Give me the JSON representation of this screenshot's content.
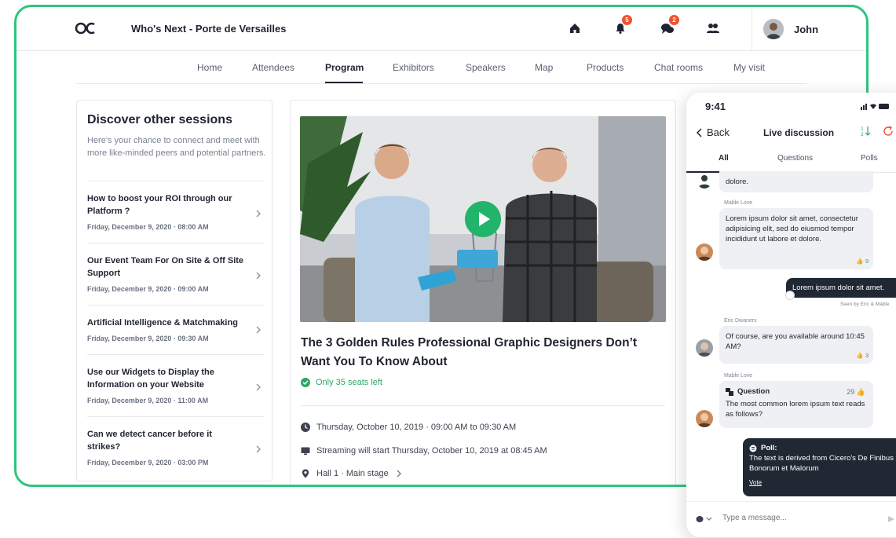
{
  "app": {
    "event_title": "Who's Next - Porte de Versailles",
    "user_name": "John",
    "badges": {
      "notifications": "5",
      "messages": "2"
    },
    "accent_color": "#2ec57d"
  },
  "nav": {
    "items": [
      "Home",
      "Attendees",
      "Program",
      "Exhibitors",
      "Speakers",
      "Map",
      "Products",
      "Chat rooms",
      "My visit"
    ],
    "active": "Program"
  },
  "sidebar": {
    "title": "Discover other sessions",
    "description": "Here's your chance to connect and meet with more like-minded peers and potential partners.",
    "sessions": [
      {
        "title": "How to boost your ROI through our Platform ?",
        "date": "Friday, December 9, 2020 · 08:00 AM"
      },
      {
        "title": "Our Event Team For On Site & Off Site Support",
        "date": "Friday, December 9, 2020 · 09:00 AM"
      },
      {
        "title": "Artificial Intelligence & Matchmaking",
        "date": "Friday, December 9, 2020 · 09:30 AM"
      },
      {
        "title": "Use our Widgets to Display the Information on your Website",
        "date": "Friday, December 9, 2020 · 11:00 AM"
      },
      {
        "title": "Can we detect cancer before it strikes?",
        "date": "Friday, December 9, 2020 · 03:00 PM"
      }
    ]
  },
  "session": {
    "title": "The 3 Golden Rules Professional Graphic Designers Don’t Want You To Know About",
    "seats": "Only 35 seats left",
    "time": "Thursday, October 10, 2019 · 09:00 AM to 09:30 AM",
    "streaming": "Streaming will start Thursday, October 10, 2019 at 08:45 AM",
    "location": "Hall 1 · Main stage"
  },
  "phone": {
    "time": "9:41",
    "back_label": "Back",
    "title": "Live discussion",
    "tabs": [
      "All",
      "Questions",
      "Polls"
    ],
    "messages": {
      "m0_text": "dolore.",
      "m1_sender": "Mable Love",
      "m1_text": "Lorem ipsum dolor sit amet, consectetur adipisicing elit, sed do eiusmod tempor incididunt ut labore et dolore.",
      "m1_likes": "9",
      "m2_text": "Lorem ipsum dolor sit amet.",
      "m2_seen": "Seen by Eric & Mable",
      "m3_sender": "Eric Dwaners",
      "m3_text": "Of course, are you available around 10:45 AM?",
      "m3_likes": "3",
      "m4_sender": "Mable Love",
      "m4_label": "Question",
      "m4_likes": "29",
      "m4_text": "The most common lorem ipsum text reads as follows?",
      "poll_label": "Poll:",
      "poll_text": "The text is derived from Cicero's De Finibus Bonorum et Malorum",
      "poll_vote": "Vote"
    },
    "input_placeholder": "Type a message..."
  }
}
